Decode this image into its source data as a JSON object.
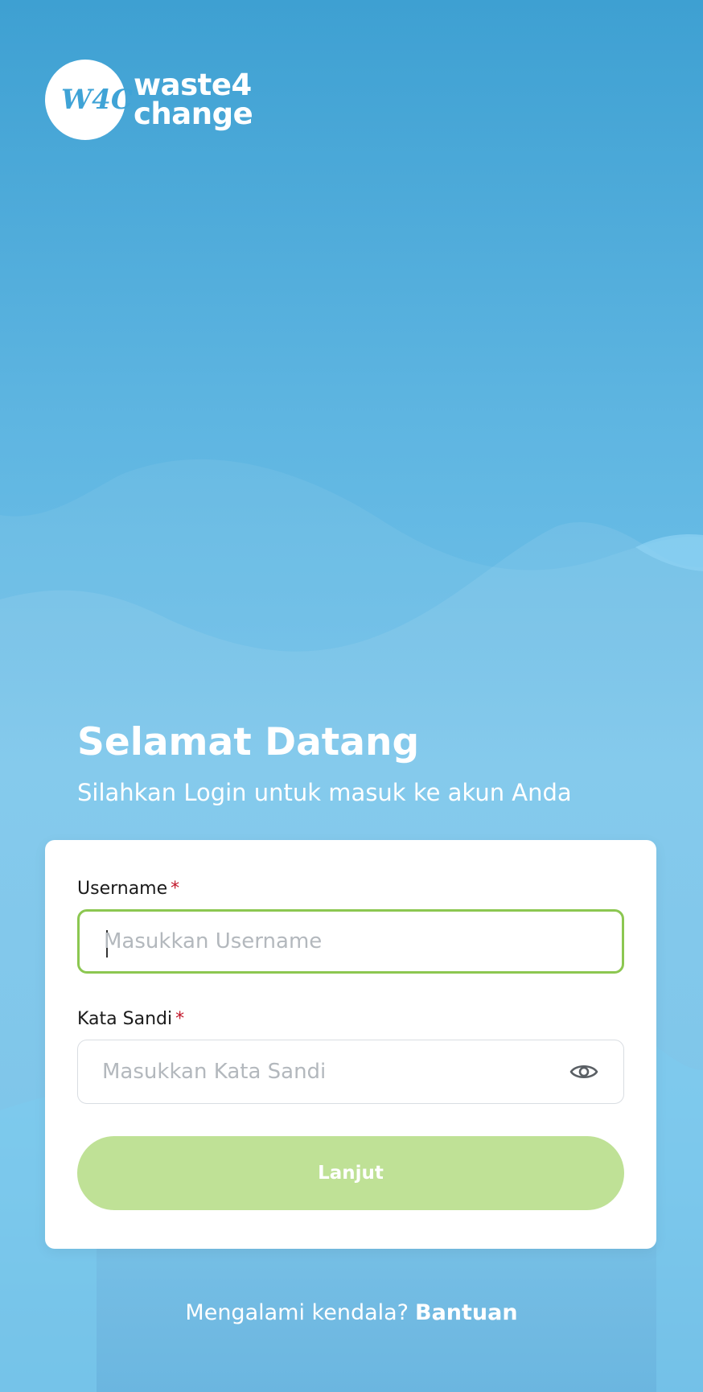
{
  "brand": {
    "logo_mark": "W4C",
    "name_line1": "waste4",
    "name_line2": "change"
  },
  "welcome": {
    "title": "Selamat Datang",
    "subtitle": "Silahkan Login untuk masuk ke akun Anda"
  },
  "form": {
    "username_label": "Username",
    "username_placeholder": "Masukkan Username",
    "username_value": "",
    "password_label": "Kata Sandi",
    "password_placeholder": "Masukkan Kata Sandi",
    "password_value": "",
    "required_marker": "*",
    "submit_label": "Lanjut",
    "toggle_icon": "eye-icon"
  },
  "footer": {
    "question": "Mengalami kendala?",
    "help_link": "Bantuan"
  },
  "colors": {
    "accent_green": "#8cc751",
    "button_green_disabled": "#bfe196",
    "background_blue": "#5eb5e1",
    "required_red": "#c2182b"
  }
}
